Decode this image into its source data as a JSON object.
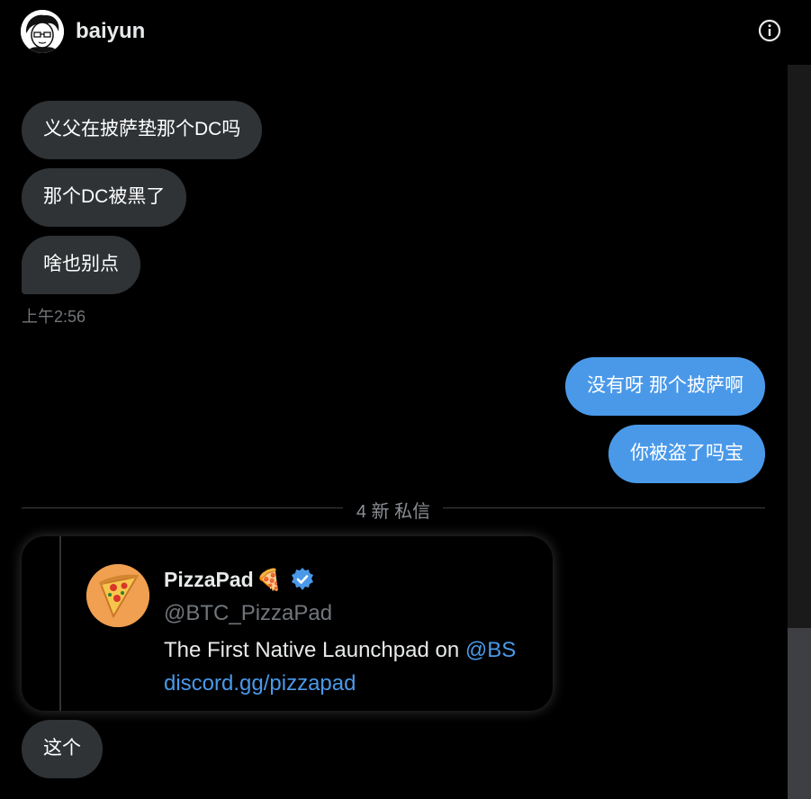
{
  "header": {
    "name": "baiyun",
    "avatar_icon": "user-avatar",
    "info_icon": "info-icon"
  },
  "messages_in": [
    {
      "text": "义父在披萨垫那个DC吗"
    },
    {
      "text": "那个DC被黑了"
    },
    {
      "text": "啥也别点"
    }
  ],
  "timestamp": "上午2:56",
  "messages_out": [
    {
      "text": "没有呀 那个披萨啊"
    },
    {
      "text": "你被盗了吗宝"
    }
  ],
  "divider": {
    "label": "4 新 私信"
  },
  "profile_card": {
    "display_name": "PizzaPad",
    "emoji": "🍕",
    "verified_icon": "verified-badge-icon",
    "handle": "@BTC_PizzaPad",
    "bio_text": "The First Native Launchpad on ",
    "bio_mention": "@BS",
    "link": "discord.gg/pizzapad"
  },
  "last_message": {
    "text": "这个"
  },
  "colors": {
    "incoming_bubble": "#2f3336",
    "outgoing_bubble": "#4a99e9",
    "link": "#4a99e9",
    "background": "#000000"
  }
}
